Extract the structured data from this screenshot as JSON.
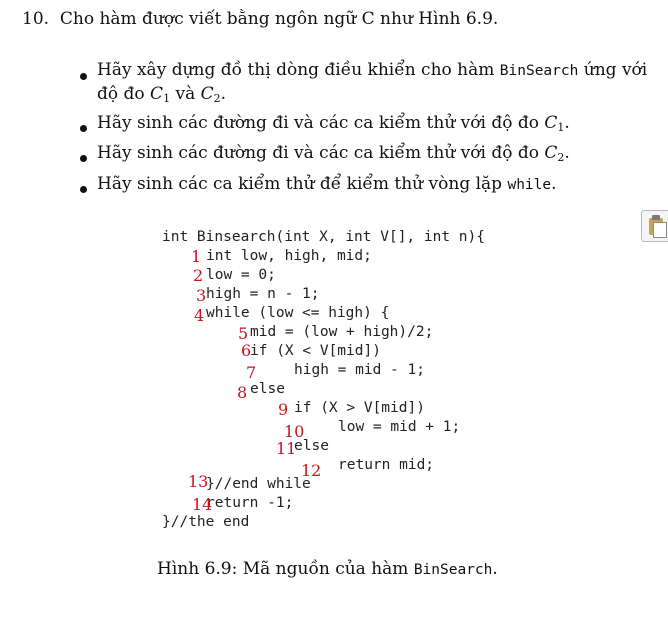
{
  "exercise": {
    "number": "10.",
    "text": "Cho hàm được viết bằng ngôn ngữ C như Hình 6.9."
  },
  "bullets": [
    {
      "pre": "Hãy xây dựng đồ thị dòng điều khiển cho hàm ",
      "code": "BinSearch",
      "post": " ứng với",
      "line2_pre": "độ đo ",
      "m1": "C",
      "m1sub": "1",
      "mid": " và ",
      "m2": "C",
      "m2sub": "2",
      "end": "."
    },
    {
      "pre": "Hãy sinh các đường đi và các ca kiểm thử với độ đo ",
      "m": "C",
      "msub": "1",
      "end": "."
    },
    {
      "pre": "Hãy sinh các đường đi và các ca kiểm thử với độ đo ",
      "m": "C",
      "msub": "2",
      "end": "."
    },
    {
      "pre": "Hãy sinh các ca kiểm thử để kiểm thử vòng lặp ",
      "code": "while",
      "end": "."
    }
  ],
  "code_lines": [
    "int Binsearch(int X, int V[], int n){",
    "int low, high, mid;",
    "low = 0;",
    "high = n - 1;",
    "while (low <= high) {",
    "mid = (low + high)/2;",
    "if (X < V[mid])",
    "high = mid - 1;",
    "else",
    "if (X > V[mid])",
    "low = mid + 1;",
    "else",
    "return mid;",
    "}//end while",
    "return -1;",
    "}//the end"
  ],
  "node_labels": [
    "1",
    "2",
    "3",
    "4",
    "5",
    "6",
    "7",
    "8",
    "9",
    "10",
    "11",
    "12",
    "13",
    "14"
  ],
  "caption": {
    "pre": "Hình 6.9: Mã nguồn của hàm ",
    "code": "BinSearch",
    "end": "."
  },
  "icons": {
    "side": "clipboard-icon"
  },
  "colors": {
    "node_label": "#c8141c"
  }
}
